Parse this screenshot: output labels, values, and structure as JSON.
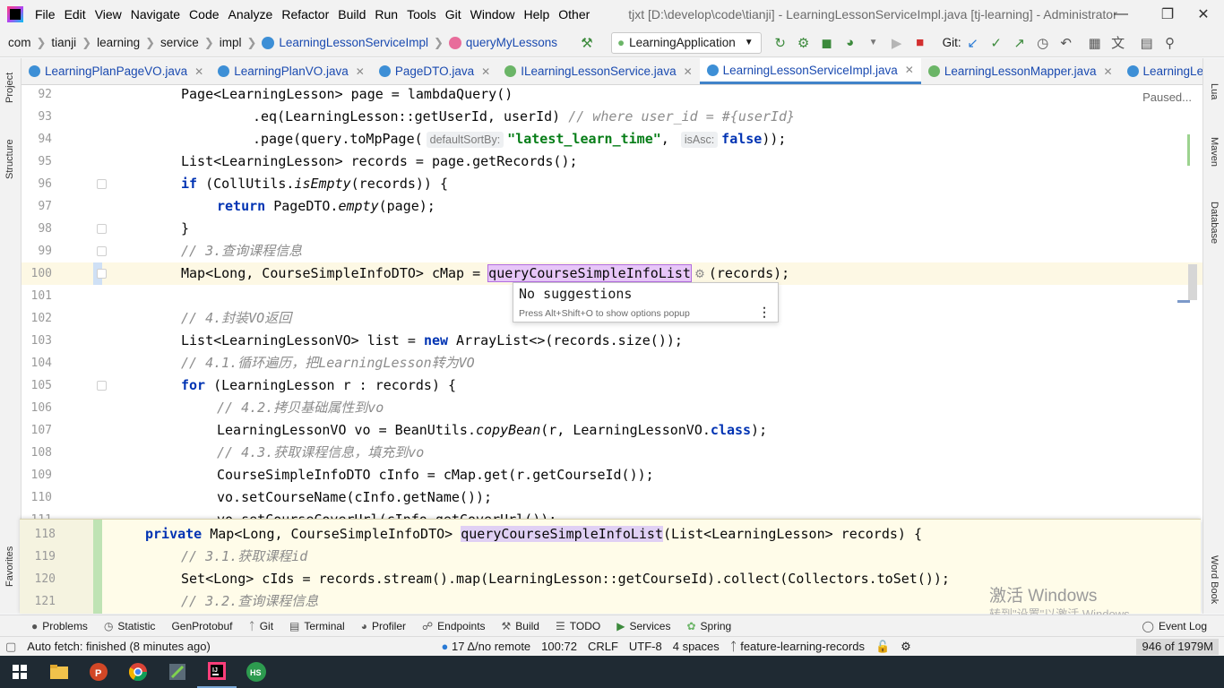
{
  "menubar": {
    "items": [
      "File",
      "Edit",
      "View",
      "Navigate",
      "Code",
      "Analyze",
      "Refactor",
      "Build",
      "Run",
      "Tools",
      "Git",
      "Window",
      "Help",
      "Other"
    ],
    "window_title": "tjxt [D:\\develop\\code\\tianji] - LearningLessonServiceImpl.java [tj-learning] - Administrator"
  },
  "breadcrumb": {
    "items": [
      "com",
      "tianji",
      "learning",
      "service",
      "impl",
      "LearningLessonServiceImpl",
      "queryMyLessons"
    ]
  },
  "toolbar": {
    "run_config": "LearningApplication",
    "git_label": "Git:"
  },
  "tabs": [
    {
      "label": "LearningPlanPageVO.java",
      "icon": "class-icon"
    },
    {
      "label": "LearningPlanVO.java",
      "icon": "class-icon"
    },
    {
      "label": "PageDTO.java",
      "icon": "class-icon"
    },
    {
      "label": "ILearningLessonService.java",
      "icon": "interface-icon"
    },
    {
      "label": "LearningLessonServiceImpl.java",
      "icon": "class-icon",
      "active": true
    },
    {
      "label": "LearningLessonMapper.java",
      "icon": "interface-icon"
    },
    {
      "label": "LearningLe",
      "icon": "class-icon"
    }
  ],
  "side": {
    "left": [
      "Project",
      "Structure",
      "Favorites"
    ],
    "right": [
      "Lua",
      "Maven",
      "Database",
      "Word Book"
    ]
  },
  "editor": {
    "status": "Paused...",
    "lines": [
      {
        "n": "92",
        "text": "Page<LearningLesson> page = lambdaQuery()"
      },
      {
        "n": "93",
        "text": ".eq(LearningLesson::getUserId, userId) // where user_id = #{userId}"
      },
      {
        "n": "94",
        "text": ".page(query.toMpPage( defaultSortBy: \"latest_learn_time\", isAsc: false));"
      },
      {
        "n": "95",
        "text": "List<LearningLesson> records = page.getRecords();"
      },
      {
        "n": "96",
        "text": "if (CollUtils.isEmpty(records)) {"
      },
      {
        "n": "97",
        "text": "return PageDTO.empty(page);"
      },
      {
        "n": "98",
        "text": "}"
      },
      {
        "n": "99",
        "text": "// 3.查询课程信息"
      },
      {
        "n": "100",
        "text": "Map<Long, CourseSimpleInfoDTO> cMap = queryCourseSimpleInfoList (records);"
      },
      {
        "n": "101",
        "text": ""
      },
      {
        "n": "102",
        "text": "// 4.封装VO返回"
      },
      {
        "n": "103",
        "text": "List<LearningLessonVO> list = new ArrayList<>(records.size());"
      },
      {
        "n": "104",
        "text": "// 4.1.循环遍历，把LearningLesson转为VO"
      },
      {
        "n": "105",
        "text": "for (LearningLesson r : records) {"
      },
      {
        "n": "106",
        "text": "// 4.2.拷贝基础属性到vo"
      },
      {
        "n": "107",
        "text": "LearningLessonVO vo = BeanUtils.copyBean(r, LearningLessonVO.class);"
      },
      {
        "n": "108",
        "text": "// 4.3.获取课程信息，填充到vo"
      },
      {
        "n": "109",
        "text": "CourseSimpleInfoDTO cInfo = cMap.get(r.getCourseId());"
      },
      {
        "n": "110",
        "text": "vo.setCourseName(cInfo.getName());"
      },
      {
        "n": "111",
        "text": "vo.setCourseCoverUrl(cInfo.getCoverUrl());"
      }
    ],
    "hints": {
      "default_sort_by": "defaultSortBy:",
      "is_asc": "isAsc:"
    }
  },
  "suggestions": {
    "title": "No suggestions",
    "hint": "Press Alt+Shift+O to show options popup"
  },
  "peek": {
    "lines": [
      {
        "n": "118",
        "text": "private Map<Long, CourseSimpleInfoDTO> queryCourseSimpleInfoList(List<LearningLesson> records) {"
      },
      {
        "n": "119",
        "text": "// 3.1.获取课程id"
      },
      {
        "n": "120",
        "text": "Set<Long> cIds = records.stream().map(LearningLesson::getCourseId).collect(Collectors.toSet());"
      },
      {
        "n": "121",
        "text": "// 3.2.查询课程信息"
      }
    ]
  },
  "watermark": {
    "title": "激活 Windows",
    "sub": "转到\"设置\"以激活 Windows。"
  },
  "bottom_tools": [
    {
      "label": "Problems",
      "icon": "problems-icon"
    },
    {
      "label": "Statistic",
      "icon": "statistic-icon"
    },
    {
      "label": "GenProtobuf",
      "icon": "protobuf-icon"
    },
    {
      "label": "Git",
      "icon": "git-icon"
    },
    {
      "label": "Terminal",
      "icon": "terminal-icon"
    },
    {
      "label": "Profiler",
      "icon": "profiler-icon"
    },
    {
      "label": "Endpoints",
      "icon": "endpoints-icon"
    },
    {
      "label": "Build",
      "icon": "build-icon"
    },
    {
      "label": "TODO",
      "icon": "todo-icon"
    },
    {
      "label": "Services",
      "icon": "services-icon"
    },
    {
      "label": "Spring",
      "icon": "spring-icon"
    }
  ],
  "event_log": "Event Log",
  "statusbar": {
    "message": "Auto fetch: finished (8 minutes ago)",
    "git_status": "17 Δ/no remote",
    "position": "100:72",
    "line_sep": "CRLF",
    "encoding": "UTF-8",
    "indent": "4 spaces",
    "branch": "feature-learning-records",
    "memory": "946 of 1979M"
  },
  "taskbar": {
    "apps": [
      "windows-start-icon",
      "file-explorer-icon",
      "powerpoint-icon",
      "chrome-icon",
      "screen-recorder-icon",
      "intellij-icon",
      "hs-icon"
    ],
    "hs_label": "HS"
  },
  "colors": {
    "keyword": "#0033b3",
    "comment": "#8c8c8c",
    "string": "#067d17",
    "current_line": "#fdf8e4",
    "highlight": "#e7c6f8",
    "tab_active_border": "#4083c9"
  }
}
